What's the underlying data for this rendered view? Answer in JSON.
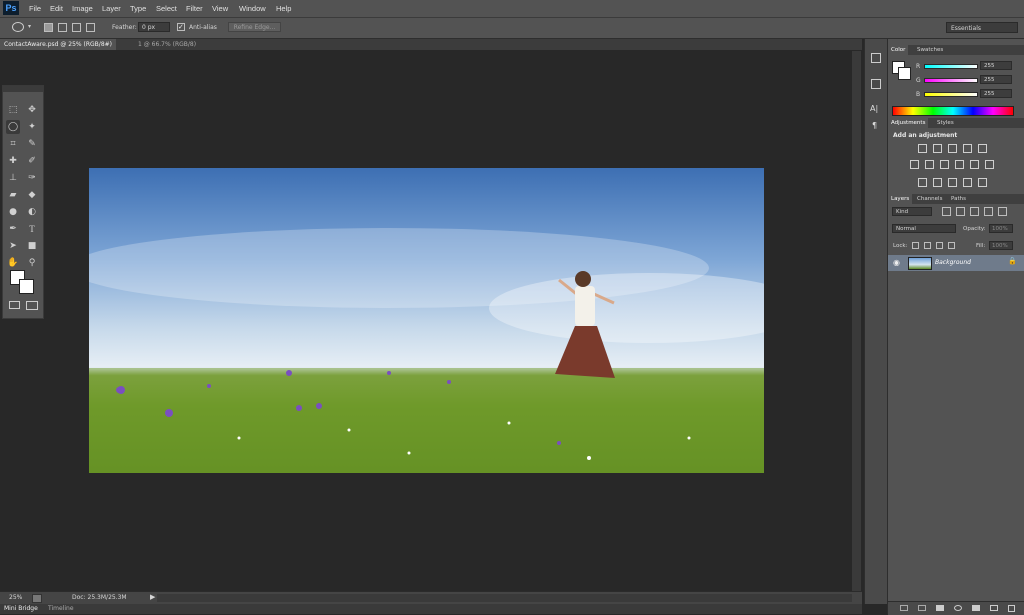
{
  "app": {
    "logo": "Ps"
  },
  "menu": [
    "File",
    "Edit",
    "Image",
    "Layer",
    "Type",
    "Select",
    "Filter",
    "View",
    "Window",
    "Help"
  ],
  "options": {
    "feather_label": "Feather:",
    "feather_value": "0 px",
    "antialias_label": "Anti-alias",
    "refine_edge": "Refine Edge...",
    "workspace": "Essentials"
  },
  "tabs": [
    {
      "label": "ContactAware.psd @ 25% (RGB/8#)"
    },
    {
      "label": "1 @ 66.7% (RGB/8)"
    }
  ],
  "color_panel": {
    "tabs": [
      "Color",
      "Swatches"
    ],
    "channels": [
      {
        "name": "R",
        "value": "255"
      },
      {
        "name": "G",
        "value": "255"
      },
      {
        "name": "B",
        "value": "255"
      }
    ]
  },
  "adjustments_panel": {
    "tabs": [
      "Adjustments",
      "Styles"
    ],
    "heading": "Add an adjustment"
  },
  "layers_panel": {
    "tabs": [
      "Layers",
      "Channels",
      "Paths"
    ],
    "filter": "Kind",
    "blend_mode": "Normal",
    "opacity_label": "Opacity:",
    "opacity_value": "100%",
    "lock_label": "Lock:",
    "fill_label": "Fill:",
    "fill_value": "100%",
    "layers": [
      {
        "name": "Background"
      }
    ]
  },
  "status": {
    "zoom": "25%",
    "doc": "Doc: 25.3M/25.3M"
  },
  "bottom_tabs": [
    "Mini Bridge",
    "Timeline"
  ]
}
